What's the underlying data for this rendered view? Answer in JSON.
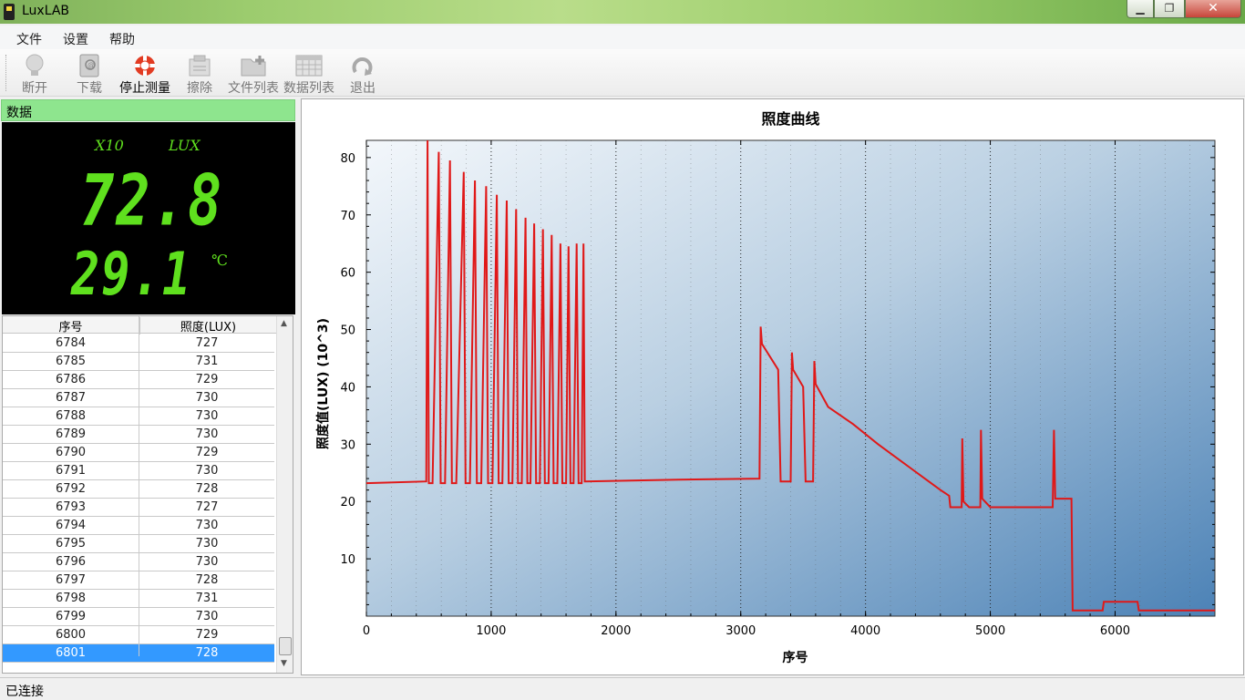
{
  "window": {
    "title": "LuxLAB"
  },
  "menu": {
    "items": [
      "文件",
      "设置",
      "帮助"
    ]
  },
  "toolbar": {
    "buttons": [
      {
        "label": "断开",
        "icon": "bulb-icon"
      },
      {
        "label": "下载",
        "icon": "download-book-icon"
      },
      {
        "label": "停止测量",
        "icon": "lifebuoy-icon"
      },
      {
        "label": "擦除",
        "icon": "erase-icon"
      },
      {
        "label": "文件列表",
        "icon": "folder-add-icon"
      },
      {
        "label": "数据列表",
        "icon": "data-list-icon"
      },
      {
        "label": "退出",
        "icon": "exit-icon"
      }
    ]
  },
  "panel": {
    "header": "数据",
    "lcd": {
      "multiplier": "X10",
      "unit": "LUX",
      "lux_value": "72.8",
      "temp_value": "29.1",
      "temp_unit": "℃"
    }
  },
  "table": {
    "headers": [
      "序号",
      "照度(LUX)"
    ],
    "rows": [
      [
        "6784",
        "727"
      ],
      [
        "6785",
        "731"
      ],
      [
        "6786",
        "729"
      ],
      [
        "6787",
        "730"
      ],
      [
        "6788",
        "730"
      ],
      [
        "6789",
        "730"
      ],
      [
        "6790",
        "729"
      ],
      [
        "6791",
        "730"
      ],
      [
        "6792",
        "728"
      ],
      [
        "6793",
        "727"
      ],
      [
        "6794",
        "730"
      ],
      [
        "6795",
        "730"
      ],
      [
        "6796",
        "730"
      ],
      [
        "6797",
        "728"
      ],
      [
        "6798",
        "731"
      ],
      [
        "6799",
        "730"
      ],
      [
        "6800",
        "729"
      ],
      [
        "6801",
        "728"
      ]
    ],
    "selected_index": 17
  },
  "status": {
    "text": "已连接"
  },
  "colors": {
    "series": "#e01818",
    "lcd": "#5fe01e",
    "header_green": "#8ee58e",
    "selection": "#3399ff"
  },
  "chart_data": {
    "type": "line",
    "title": "照度曲线",
    "xlabel": "序号",
    "ylabel": "照度值(LUX)  (10^3)",
    "xlim": [
      0,
      6800
    ],
    "ylim": [
      0,
      83
    ],
    "xticks": [
      0,
      1000,
      2000,
      3000,
      4000,
      5000,
      6000
    ],
    "yticks": [
      10,
      20,
      30,
      40,
      50,
      60,
      70,
      80
    ],
    "grid": true,
    "series": [
      {
        "points": [
          [
            0,
            23.2
          ],
          [
            480,
            23.5
          ],
          [
            490,
            83
          ],
          [
            500,
            23.2
          ],
          [
            530,
            23.2
          ],
          [
            580,
            81
          ],
          [
            595,
            23.2
          ],
          [
            630,
            23.2
          ],
          [
            670,
            79.5
          ],
          [
            685,
            23.2
          ],
          [
            720,
            23.2
          ],
          [
            780,
            77.5
          ],
          [
            795,
            23.2
          ],
          [
            830,
            23.2
          ],
          [
            870,
            76
          ],
          [
            885,
            23.2
          ],
          [
            920,
            23.2
          ],
          [
            960,
            75
          ],
          [
            975,
            23.2
          ],
          [
            1010,
            23.2
          ],
          [
            1045,
            73.5
          ],
          [
            1060,
            23.2
          ],
          [
            1090,
            23.2
          ],
          [
            1125,
            72.5
          ],
          [
            1140,
            23.2
          ],
          [
            1170,
            23.2
          ],
          [
            1200,
            71
          ],
          [
            1215,
            23.2
          ],
          [
            1245,
            23.2
          ],
          [
            1275,
            69.5
          ],
          [
            1290,
            23.2
          ],
          [
            1315,
            23.2
          ],
          [
            1345,
            68.5
          ],
          [
            1360,
            23.2
          ],
          [
            1390,
            23.2
          ],
          [
            1415,
            67.5
          ],
          [
            1430,
            23.2
          ],
          [
            1460,
            23.2
          ],
          [
            1485,
            66.5
          ],
          [
            1500,
            23.2
          ],
          [
            1530,
            23.2
          ],
          [
            1555,
            65
          ],
          [
            1570,
            23.2
          ],
          [
            1600,
            23.2
          ],
          [
            1620,
            64.5
          ],
          [
            1635,
            23.2
          ],
          [
            1660,
            23.2
          ],
          [
            1685,
            65
          ],
          [
            1700,
            23.2
          ],
          [
            1725,
            23.2
          ],
          [
            1740,
            65
          ],
          [
            1750,
            23.5
          ],
          [
            2500,
            23.8
          ],
          [
            3150,
            24
          ],
          [
            3160,
            50.5
          ],
          [
            3170,
            47.5
          ],
          [
            3300,
            43
          ],
          [
            3320,
            23.5
          ],
          [
            3400,
            23.5
          ],
          [
            3410,
            46
          ],
          [
            3420,
            43
          ],
          [
            3500,
            40
          ],
          [
            3520,
            23.5
          ],
          [
            3580,
            23.5
          ],
          [
            3590,
            44.5
          ],
          [
            3600,
            40.5
          ],
          [
            3700,
            36.5
          ],
          [
            3900,
            33.5
          ],
          [
            4100,
            30
          ],
          [
            4350,
            26
          ],
          [
            4600,
            22
          ],
          [
            4670,
            21
          ],
          [
            4680,
            19
          ],
          [
            4770,
            19
          ],
          [
            4775,
            31
          ],
          [
            4785,
            20
          ],
          [
            4830,
            19
          ],
          [
            4920,
            19
          ],
          [
            4925,
            32.5
          ],
          [
            4935,
            20.5
          ],
          [
            5000,
            19
          ],
          [
            5500,
            19
          ],
          [
            5510,
            32.5
          ],
          [
            5520,
            20.5
          ],
          [
            5650,
            20.5
          ],
          [
            5660,
            1
          ],
          [
            5900,
            1
          ],
          [
            5910,
            2.5
          ],
          [
            6180,
            2.5
          ],
          [
            6190,
            1
          ],
          [
            6800,
            1
          ]
        ]
      }
    ]
  }
}
